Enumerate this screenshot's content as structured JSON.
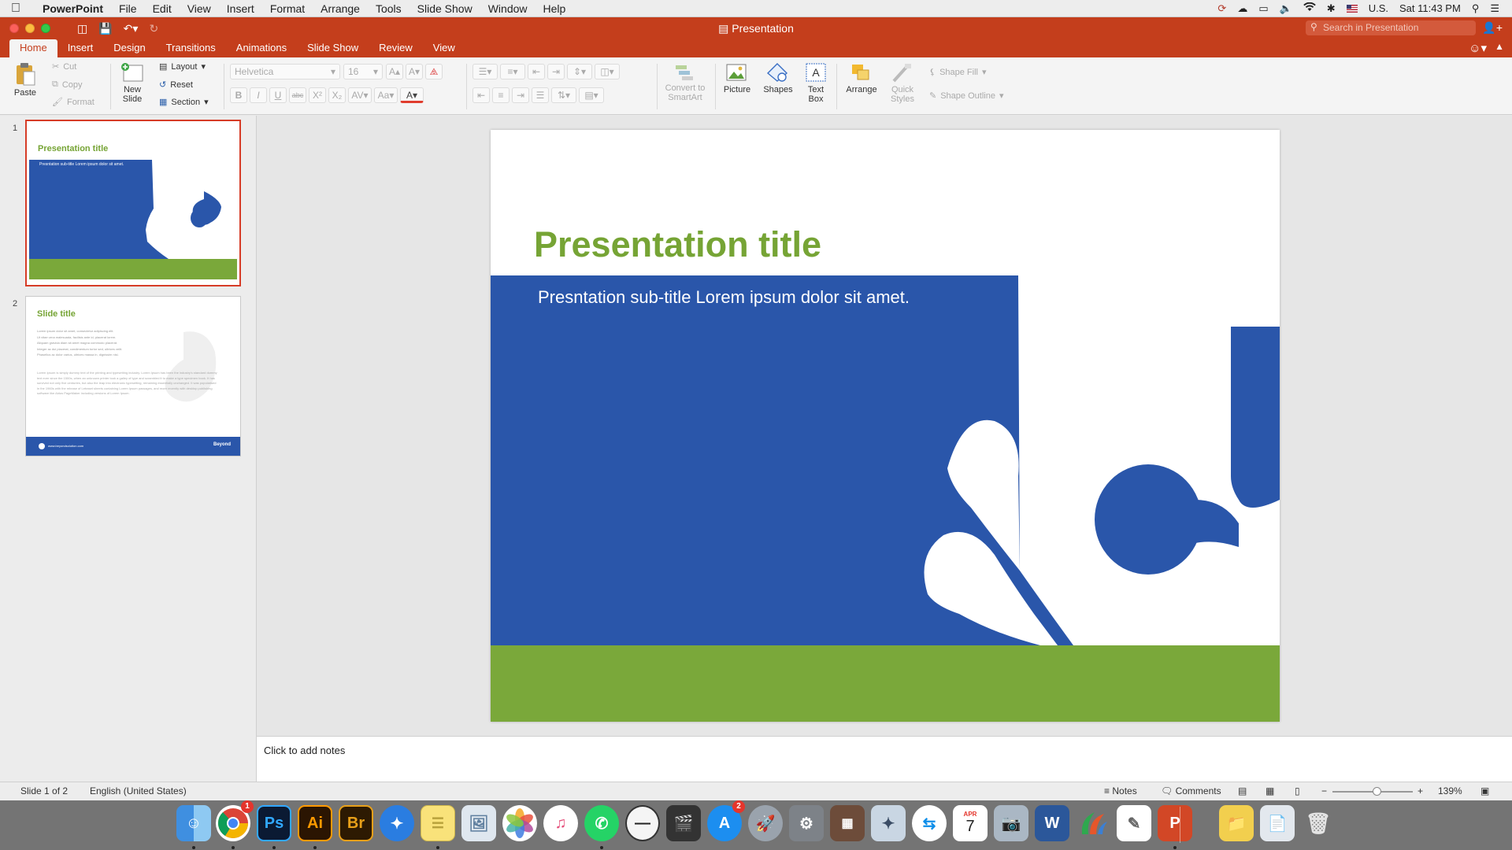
{
  "menubar": {
    "app_name": "PowerPoint",
    "items": [
      "File",
      "Edit",
      "View",
      "Insert",
      "Format",
      "Arrange",
      "Tools",
      "Slide Show",
      "Window",
      "Help"
    ],
    "input_source": "U.S.",
    "clock": "Sat 11:43 PM"
  },
  "titlebar": {
    "document_title": "Presentation",
    "search_placeholder": "Search in Presentation"
  },
  "ribbon": {
    "tabs": [
      "Home",
      "Insert",
      "Design",
      "Transitions",
      "Animations",
      "Slide Show",
      "Review",
      "View"
    ],
    "active_tab": "Home",
    "paste": "Paste",
    "cut": "Cut",
    "copy": "Copy",
    "format": "Format",
    "new_slide_1": "New",
    "new_slide_2": "Slide",
    "layout": "Layout",
    "reset": "Reset",
    "section": "Section",
    "font_name": "Helvetica",
    "font_size": "16",
    "convert_smartart_1": "Convert to",
    "convert_smartart_2": "SmartArt",
    "picture": "Picture",
    "shapes": "Shapes",
    "text_box_1": "Text",
    "text_box_2": "Box",
    "arrange": "Arrange",
    "quick_styles_1": "Quick",
    "quick_styles_2": "Styles",
    "shape_fill": "Shape Fill",
    "shape_outline": "Shape Outline"
  },
  "thumbnails": [
    {
      "number": "1",
      "title": "Presentation title",
      "subtitle": "Presntation sub-title Lorem ipsum dolor sit amet."
    },
    {
      "number": "2",
      "title": "Slide title",
      "bullets": [
        "Lorem ipsum dolor sit amet, consectetur adipiscing elit.",
        "Ut vitae urna malesuada, facilisis ante id, placerat lorem.",
        "Aliquam gravida diam sit amet magna commodo placerat.",
        "Integer ac dui placerat, condimentum tortor sed, ultrices velit.",
        "Phasellus ac dolor varius, ultrices massa in, dignissim nisl."
      ],
      "body": "Lorem Ipsum is simply dummy text of the printing and typesetting industry. Lorem Ipsum has been the industry's standard dummy text ever since the 1500s, when an unknown printer took a galley of type and scrambled it to make a type specimen book. It has survived not only five centuries, but also the leap into electronic typesetting, remaining essentially unchanged. It was popularised in the 1960s with the release of Letraset sheets containing Lorem Ipsum passages, and more recently with desktop publishing software like Aldus PageMaker including versions of Lorem Ipsum.",
      "footer_url": "www.beyondsolution.com",
      "footer_logo": "Beyond"
    }
  ],
  "slide": {
    "title": "Presentation title",
    "subtitle": "Presntation sub-title Lorem ipsum dolor sit amet.",
    "colors": {
      "title_green": "#76a435",
      "band_blue": "#2a56aa",
      "band_green": "#7aa83a"
    }
  },
  "notes": {
    "placeholder": "Click to add notes"
  },
  "statusbar": {
    "slide_counter": "Slide 1 of 2",
    "language": "English (United States)",
    "notes": "Notes",
    "comments": "Comments",
    "zoom": "139%"
  },
  "dock": {
    "apps": [
      "Finder",
      "Chrome",
      "Photoshop",
      "Illustrator",
      "Bridge",
      "Safari",
      "Notes",
      "Preview",
      "Photos",
      "iTunes",
      "WhatsApp",
      "Codeshot",
      "Final Cut",
      "App Store",
      "Launchpad",
      "System Preferences",
      "Calculator",
      "Preview Editor",
      "TeamViewer",
      "Calendar",
      "Image Capture",
      "Word",
      "Open Office",
      "TextEdit",
      "PowerPoint",
      "Downloads",
      "Documents",
      "Trash"
    ],
    "app_store_badge": "2",
    "chrome_badge": "1",
    "calendar_month": "APR",
    "calendar_day": "7"
  }
}
